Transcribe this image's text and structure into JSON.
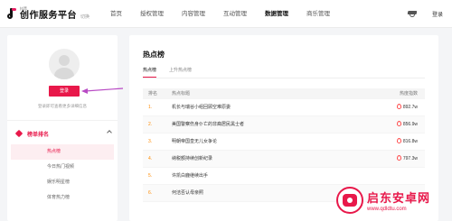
{
  "header": {
    "logo_small": "抖音",
    "logo_main": "创作服务平台",
    "logo_tag": "切换",
    "nav": [
      "首页",
      "授权管理",
      "内容管理",
      "互动管理",
      "数据管理",
      "商乐管理"
    ],
    "active_nav": "数据管理",
    "login_label": "登录"
  },
  "sidebar": {
    "login_button": "登录",
    "login_hint": "登录即可查看更多详细信息",
    "section_label": "榜单排名",
    "items": [
      {
        "label": "热点榜",
        "active": true
      },
      {
        "label": "今日热门视频",
        "active": false
      },
      {
        "label": "娱乐明星榜",
        "active": false
      },
      {
        "label": "体育热力榜",
        "active": false
      }
    ]
  },
  "main": {
    "title": "热点榜",
    "tabs": [
      "热点榜",
      "上升热点榜"
    ],
    "active_tab": "热点榜",
    "columns": {
      "rank": "排名",
      "title": "热点标题",
      "heat": "热度指数"
    },
    "rows": [
      {
        "rank": "1.",
        "title": "机长与瑞谷小组回顾空难原委",
        "heat": "892.7w"
      },
      {
        "rank": "2.",
        "title": "美国警察伤身仆亡的非裔居民黑士者",
        "heat": "856.9w"
      },
      {
        "rank": "3.",
        "title": "明朝帝国皇无儿女争论",
        "heat": "816.8w"
      },
      {
        "rank": "4.",
        "title": "纳税额持续创新纪录",
        "heat": "797.3w"
      },
      {
        "rank": "5.",
        "title": "许凯白鹿继续出手",
        "heat": ""
      },
      {
        "rank": "6.",
        "title": "何洁否认母亲照",
        "heat": ""
      }
    ]
  },
  "watermark": {
    "title": "启东安卓网",
    "url": "www.qdldtu.com"
  },
  "colors": {
    "brand": "#e8184a",
    "rank": "#ff8a00"
  }
}
